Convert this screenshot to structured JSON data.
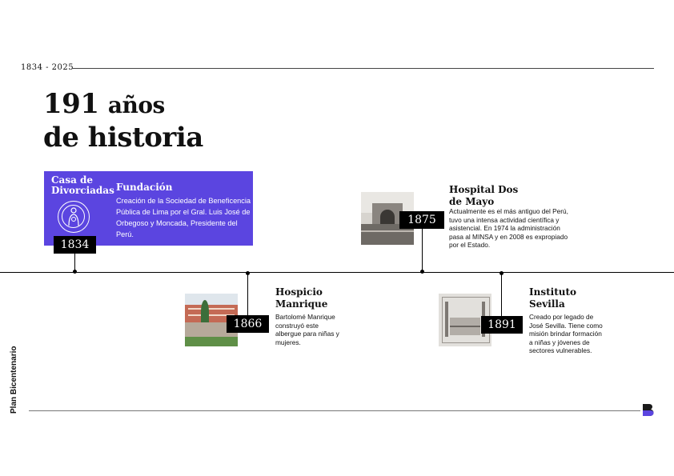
{
  "header": {
    "years": "1834 - 2025"
  },
  "title": {
    "line1_number": "191",
    "line1_word": "años",
    "line2": "de historia"
  },
  "sidebar_label": "Plan Bicentenario",
  "accent_color": "#5b45e0",
  "events": {
    "e1834": {
      "org_name": "Casa de Divorciadas",
      "heading": "Fundación",
      "text": "Creación de la Sociedad de Beneficencia Pública de Lima por el Gral. Luis José de Orbegoso y Moncada, Presidente del Perú.",
      "year": "1834",
      "icon": "beneficence-seal-icon"
    },
    "e1866": {
      "heading": "Hospicio Manrique",
      "text": "Bartolomé Manrique construyó este albergue para niñas y mujeres.",
      "year": "1866"
    },
    "e1875": {
      "heading": "Hospital Dos de Mayo",
      "text": "Actualmente es el más antiguo del Perú, tuvo una intensa actividad científica y asistencial. En 1974 la administración pasa al MINSA y en 2008 es expropiado por el Estado.",
      "year": "1875"
    },
    "e1891": {
      "heading": "Instituto Sevilla",
      "text": "Creado por legado de José Sevilla. Tiene como misión brindar formación a niñas y jóvenes de sectores vulnerables.",
      "year": "1891"
    }
  },
  "logo_icon": "plan-bicentenario-b-icon"
}
